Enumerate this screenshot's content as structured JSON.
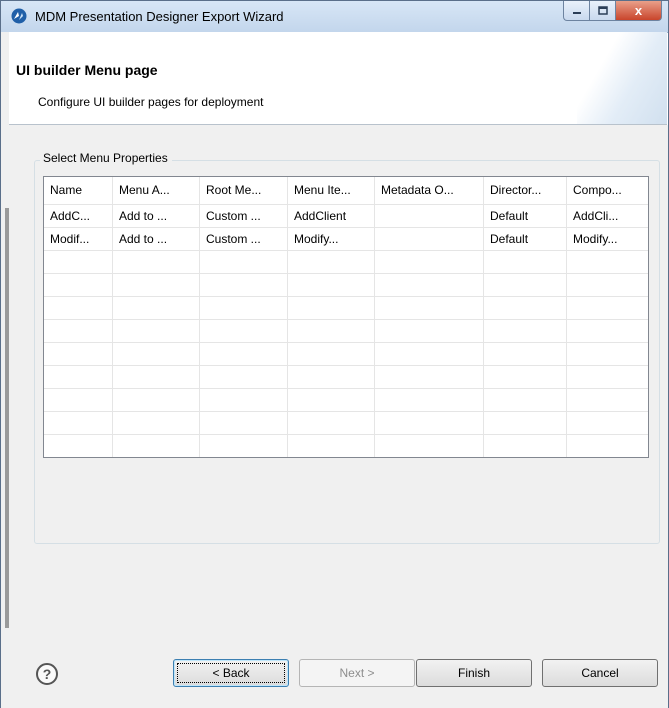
{
  "window": {
    "title": "MDM Presentation Designer Export Wizard",
    "controls": {
      "minimize": "–",
      "maximize": "□",
      "close": "x"
    }
  },
  "header": {
    "title": "UI builder Menu page",
    "description": "Configure UI builder pages for deployment"
  },
  "group": {
    "label": "Select Menu Properties"
  },
  "table": {
    "columns": [
      "Name",
      "Menu A...",
      "Root Me...",
      "Menu Ite...",
      "Metadata O...",
      "Director...",
      "Compo..."
    ],
    "rows": [
      [
        "AddC...",
        "Add to ...",
        "Custom ...",
        "AddClient",
        "",
        "Default",
        "AddCli..."
      ],
      [
        "Modif...",
        "Add to ...",
        "Custom ...",
        "Modify...",
        "",
        "Default",
        "Modify..."
      ]
    ]
  },
  "footer": {
    "help": "?",
    "back_label": "< Back",
    "next_label": "Next >",
    "finish_label": "Finish",
    "cancel_label": "Cancel"
  },
  "colors": {
    "title_bar": "#c3d6ec",
    "close_button": "#c9452c",
    "dialog_bg": "#f0f0f0"
  }
}
